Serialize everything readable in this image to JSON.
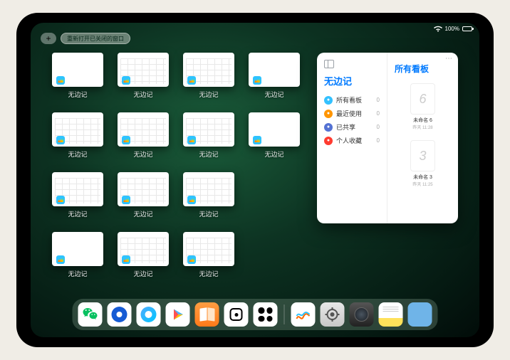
{
  "status": {
    "battery_pct": "100%"
  },
  "top_controls": {
    "plus_label": "+",
    "reopen_label": "重新打开已关闭的窗口"
  },
  "thumb_app_name": "无边记",
  "thumbs": [
    {
      "variant": "blank"
    },
    {
      "variant": "cal"
    },
    {
      "variant": "cal"
    },
    {
      "variant": "blank"
    },
    {
      "variant": "cal"
    },
    {
      "variant": "cal"
    },
    {
      "variant": "cal"
    },
    {
      "variant": "blank"
    },
    {
      "variant": "cal"
    },
    {
      "variant": "cal"
    },
    {
      "variant": "cal"
    },
    {
      "variant": "gap"
    },
    {
      "variant": "blank"
    },
    {
      "variant": "cal"
    },
    {
      "variant": "cal"
    }
  ],
  "panel": {
    "left_title": "无边记",
    "right_title": "所有看板",
    "rows": [
      {
        "color": "#33c1ff",
        "label": "所有看板",
        "count": "0"
      },
      {
        "color": "#ff9500",
        "label": "最近使用",
        "count": "0"
      },
      {
        "color": "#5472d3",
        "label": "已共享",
        "count": "0"
      },
      {
        "color": "#ff3b30",
        "label": "个人收藏",
        "count": "0"
      }
    ],
    "boards": [
      {
        "glyph": "6",
        "title": "未命名 6",
        "date": "昨天 11:28"
      },
      {
        "glyph": "3",
        "title": "未命名 3",
        "date": "昨天 11:25"
      }
    ]
  },
  "dock": {
    "apps": [
      {
        "id": "wechat"
      },
      {
        "id": "qq"
      },
      {
        "id": "browser"
      },
      {
        "id": "play"
      },
      {
        "id": "books"
      },
      {
        "id": "dice"
      },
      {
        "id": "grid"
      }
    ],
    "recent": [
      {
        "id": "freeform"
      },
      {
        "id": "settings"
      },
      {
        "id": "camera"
      },
      {
        "id": "notes"
      },
      {
        "id": "folder"
      }
    ]
  }
}
